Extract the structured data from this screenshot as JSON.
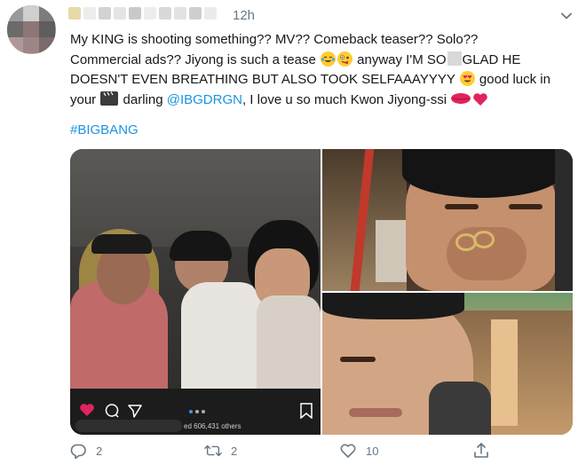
{
  "tweet": {
    "time": "12h",
    "line1": "My KING is shooting something?? MV?? Comeback teaser?? Solo??",
    "line2_a": "Commercial ads?? Jiyong is such a tease",
    "line2_b": "anyway I'M SO",
    "line2_c": "GLAD HE",
    "line3_a": "DOESN'T EVEN BREATHING BUT ALSO TOOK SELFAAAYYYY",
    "line3_b": "good luck in",
    "line4_a": "your",
    "line4_b": "darling",
    "mention": "@IBGDRGN",
    "line4_c": ", I love u so much Kwon Jiyong-ssi",
    "hashtag": "#BIGBANG"
  },
  "media": {
    "story_caption": "ed 606,431 others"
  },
  "actions": {
    "reply_count": "2",
    "retweet_count": "2",
    "like_count": "10"
  },
  "colors": {
    "link": "#1b95e0",
    "muted": "#657786",
    "text": "#14171a",
    "like": "#e0245e"
  },
  "icons": [
    "chevron-down-icon",
    "face-tears-of-joy-icon",
    "zany-face-icon",
    "heart-eyes-icon",
    "clapper-board-icon",
    "kiss-mark-icon",
    "red-heart-icon",
    "reply-icon",
    "retweet-icon",
    "like-icon",
    "share-icon"
  ]
}
